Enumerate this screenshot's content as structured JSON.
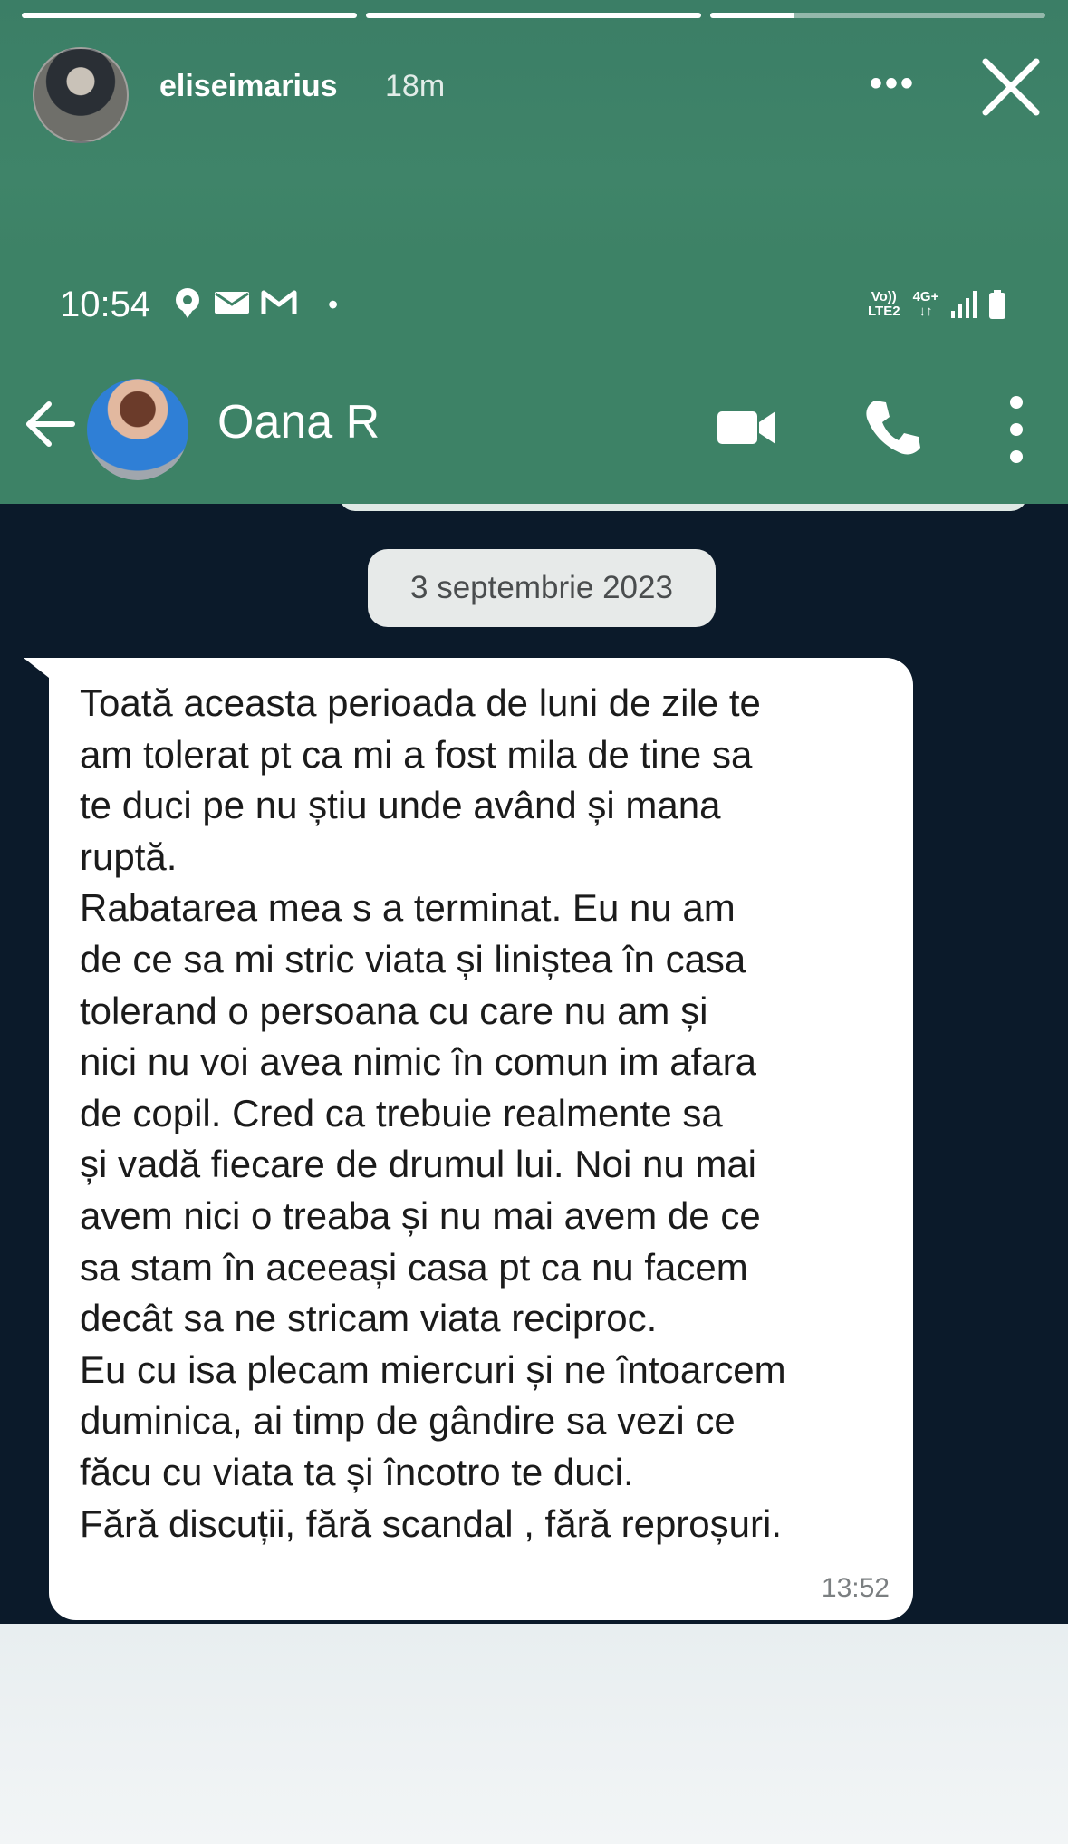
{
  "story": {
    "username": "eliseimarius",
    "time": "18m",
    "progress": [
      1.0,
      1.0,
      0.25
    ]
  },
  "status_bar": {
    "time": "10:54",
    "dot": "•",
    "network_line1": "Vo))",
    "network_line2": "LTE2",
    "network_gen": "4G+"
  },
  "chat_header": {
    "contact_name": "Oana R"
  },
  "chat": {
    "date": "3 septembrie 2023",
    "message_lines": [
      "Toată aceasta perioada de luni de zile te",
      "am tolerat pt ca mi a fost mila de tine sa",
      "te duci pe nu știu unde având și mana",
      "ruptă.",
      "Rabatarea mea s a terminat. Eu nu am",
      "de ce sa mi stric viata și liniștea în casa",
      "tolerand o persoana cu care nu am și",
      "nici nu voi avea nimic în comun im afara",
      "de copil. Cred ca trebuie realmente sa",
      "și vadă fiecare de drumul lui. Noi nu mai",
      "avem nici o treaba și nu mai avem de ce",
      "sa stam în aceeași casa pt ca nu facem",
      "decât sa ne stricam viata reciproc.",
      "Eu cu isa plecam miercuri și ne întoarcem",
      "duminica, ai timp de gândire sa vezi ce",
      "făcu cu viata ta și încotro te duci.",
      "Fără discuții, fără scandal , fără reproșuri."
    ],
    "message_time": "13:52"
  }
}
